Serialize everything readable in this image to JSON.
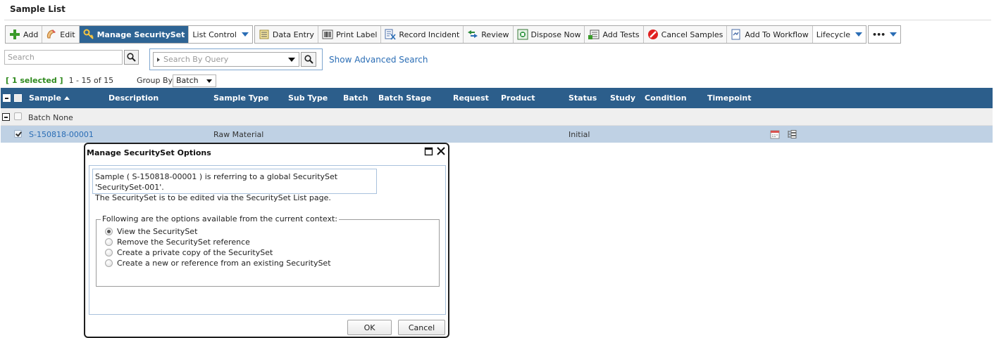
{
  "page": {
    "title": "Sample List"
  },
  "toolbar": {
    "add": "Add",
    "edit": "Edit",
    "manage_security": "Manage SecuritySet",
    "list_control": "List Control",
    "data_entry": "Data Entry",
    "print_label": "Print Label",
    "record_incident": "Record Incident",
    "review": "Review",
    "dispose_now": "Dispose Now",
    "add_tests": "Add Tests",
    "cancel_samples": "Cancel Samples",
    "add_to_workflow": "Add To Workflow",
    "lifecycle": "Lifecycle",
    "more": "•••"
  },
  "search": {
    "placeholder": "Search",
    "query_placeholder": "Search By Query",
    "advanced_link": "Show Advanced Search"
  },
  "selection": {
    "count": "[ 1 selected ]",
    "range": "1 - 15 of 15",
    "group_by_label": "Group By",
    "group_by_value": "Batch"
  },
  "grid": {
    "columns": [
      "Sample",
      "Description",
      "Sample Type",
      "Sub Type",
      "Batch",
      "Batch Stage",
      "Request",
      "Product",
      "Status",
      "Study",
      "Condition",
      "Timepoint"
    ],
    "group": {
      "label": "Batch None"
    },
    "rows": [
      {
        "sample": "S-150818-00001",
        "sample_type": "Raw Material",
        "status": "Initial"
      }
    ]
  },
  "dialog": {
    "title": "Manage SecuritySet Options",
    "message_line1": "Sample ( S-150818-00001 ) is referring to a global SecuritySet 'SecuritySet-001'.",
    "message_line2": "The SecuritySet is to be edited via the SecuritySet List page.",
    "legend": "Following are the options available from the current context:",
    "options": [
      {
        "label": "View the SecuritySet",
        "selected": true
      },
      {
        "label": "Remove the SecuritySet reference",
        "selected": false
      },
      {
        "label": "Create a private copy of the SecuritySet",
        "selected": false
      },
      {
        "label": "Create a new or reference from an existing SecuritySet",
        "selected": false
      }
    ],
    "ok": "OK",
    "cancel": "Cancel"
  },
  "colors": {
    "header_bg": "#2c5e8b",
    "active_button": "#2e6494",
    "selected_row": "#bfd1e4",
    "link": "#2a6db5",
    "selected_count": "#2f8a1e"
  }
}
